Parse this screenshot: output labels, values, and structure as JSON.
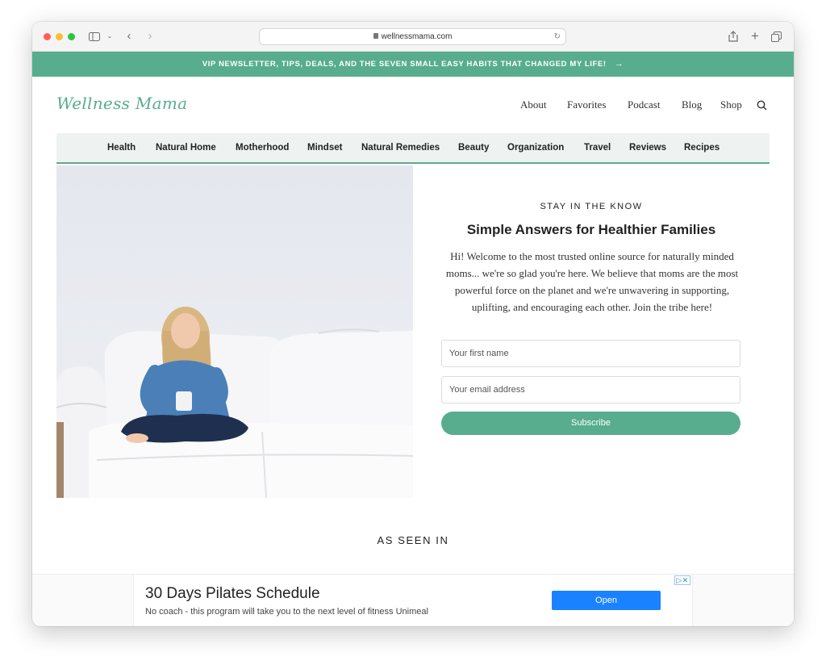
{
  "browser": {
    "url": "wellnessmama.com"
  },
  "announcement": {
    "text": "VIP NEWSLETTER, TIPS, DEALS, AND THE SEVEN SMALL EASY HABITS THAT CHANGED MY LIFE!",
    "arrow": "→"
  },
  "header": {
    "logo": "Wellness Mama",
    "nav": [
      "About",
      "Favorites",
      "Podcast",
      "Blog",
      "Shop"
    ]
  },
  "categories": [
    "Health",
    "Natural Home",
    "Motherhood",
    "Mindset",
    "Natural Remedies",
    "Beauty",
    "Organization",
    "Travel",
    "Reviews",
    "Recipes"
  ],
  "optin": {
    "eyebrow": "STAY IN THE KNOW",
    "headline": "Simple Answers for Healthier Families",
    "intro": "Hi! Welcome to the most trusted online source for naturally minded moms... we're so glad you're here. We believe that moms are the most powerful force on the planet and we're unwavering in supporting, uplifting, and encouraging each other. Join the tribe here!",
    "first_name_placeholder": "Your first name",
    "email_placeholder": "Your email address",
    "subscribe_label": "Subscribe"
  },
  "as_seen_in": "AS SEEN IN",
  "ad": {
    "title": "30 Days Pilates Schedule",
    "description": "No coach - this program will take you to the next level of fitness Unimeal",
    "cta": "Open"
  },
  "colors": {
    "brand_green": "#57ad8e",
    "ad_button": "#1a82ff"
  }
}
